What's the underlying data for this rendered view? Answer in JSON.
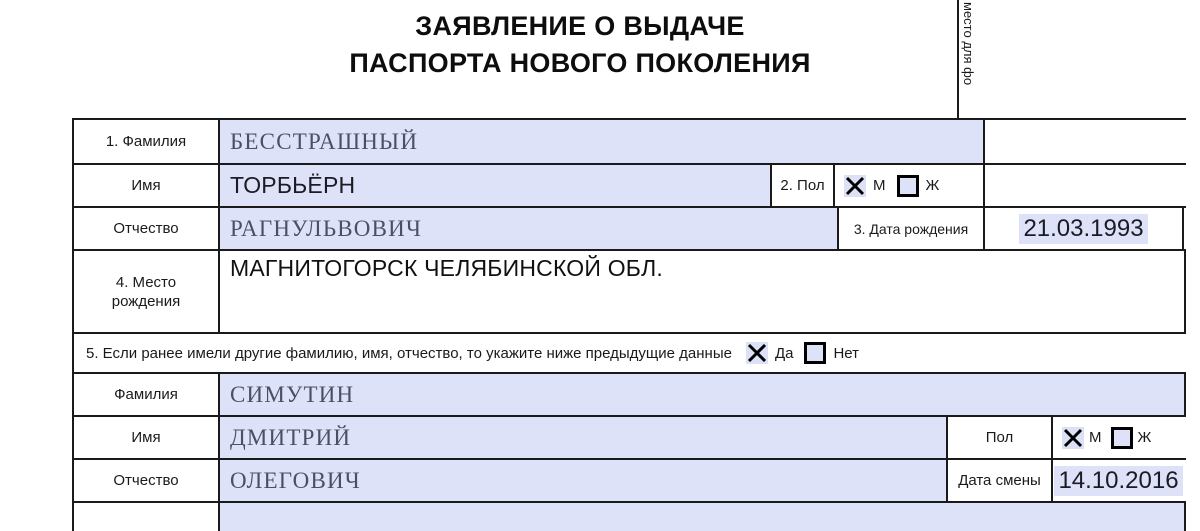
{
  "document": {
    "title_line1": "ЗАЯВЛЕНИЕ О ВЫДАЧЕ",
    "title_line2": "ПАСПОРТА НОВОГО ПОКОЛЕНИЯ",
    "photo_slot_label": "место для фо"
  },
  "fields": {
    "surname": {
      "label": "1. Фамилия",
      "value": "БЕССТРАШНЫЙ"
    },
    "firstname": {
      "label": "Имя",
      "value": "ТОРБЬЁРН"
    },
    "patronymic": {
      "label": "Отчество",
      "value": "РАГНУЛЬВОВИЧ"
    },
    "sex": {
      "label": "2. Пол",
      "male_label": "М",
      "female_label": "Ж",
      "male_checked": "✕",
      "female_checked": ""
    },
    "birthdate": {
      "label": "3. Дата рождения",
      "value": "21.03.1993"
    },
    "birthplace": {
      "label_line1": "4. Место",
      "label_line2": "рождения",
      "value": "МАГНИТОГОРСК ЧЕЛЯБИНСКОЙ ОБЛ."
    }
  },
  "previous_data": {
    "question": "5. Если ранее имели другие фамилию, имя, отчество, то укажите ниже предыдущие данные",
    "yes_label": "Да",
    "no_label": "Нет",
    "yes_checked": "✕",
    "no_checked": "",
    "surname": {
      "label": "Фамилия",
      "value": "СИМУТИН"
    },
    "firstname": {
      "label": "Имя",
      "value": "ДМИТРИЙ"
    },
    "patronymic": {
      "label": "Отчество",
      "value": "ОЛЕГОВИЧ"
    },
    "sex": {
      "label": "Пол",
      "male_label": "М",
      "female_label": "Ж",
      "male_checked": "✕",
      "female_checked": ""
    },
    "change_date": {
      "label": "Дата смены",
      "value": "14.10.2016"
    }
  },
  "colors": {
    "field_fill": "#dee2f8",
    "border": "#1a1a1a",
    "text": "#1a1a1a",
    "filled_text": "#4c4f63"
  }
}
